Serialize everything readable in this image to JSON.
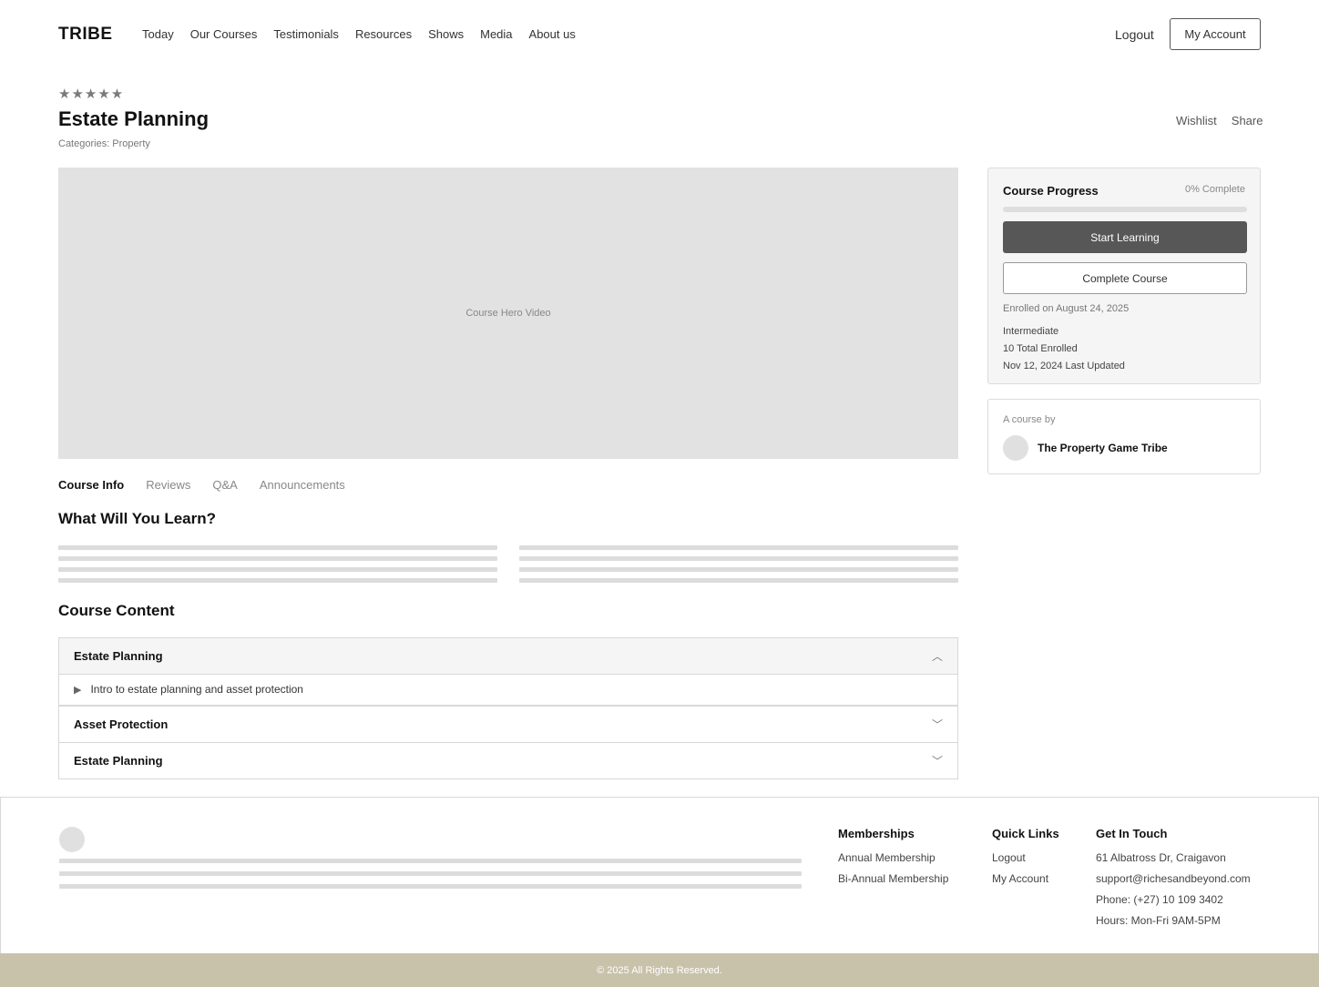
{
  "header": {
    "logo": "TRIBE",
    "nav": [
      "Today",
      "Our Courses",
      "Testimonials",
      "Resources",
      "Shows",
      "Media",
      "About us"
    ],
    "logout": "Logout",
    "my_account": "My Account"
  },
  "course": {
    "stars": "★★★★★",
    "rating_stars": 5,
    "title": "Estate Planning",
    "categories": "Categories: Property",
    "wishlist": "Wishlist",
    "share": "Share",
    "video_label": "Course Hero Video"
  },
  "tabs": [
    "Course Info",
    "Reviews",
    "Q&A",
    "Announcements"
  ],
  "learn": {
    "title": "What Will You Learn?"
  },
  "content": {
    "title": "Course Content",
    "topics": [
      {
        "label": "Estate Planning",
        "chevron": "︿",
        "lesson": "Intro to estate planning and asset protection"
      },
      {
        "label": "Asset Protection",
        "chevron": "﹀"
      },
      {
        "label": "Estate Planning",
        "chevron": "﹀"
      }
    ],
    "play_icon": "▶"
  },
  "progress": {
    "title": "Course Progress",
    "percent_label": "0% Complete",
    "percent_value": 0,
    "start_label": "Start Learning",
    "complete_label": "Complete Course",
    "enrolled_on": "Enrolled on August 24, 2025",
    "level": "Intermediate",
    "total_enrolled": "10 Total Enrolled",
    "last_updated": "Nov 12, 2024 Last Updated"
  },
  "author": {
    "label": "A course by",
    "name": "The Property Game Tribe"
  },
  "footer": {
    "memberships": {
      "title": "Memberships",
      "items": [
        "Annual Membership",
        "Bi-Annual Membership"
      ]
    },
    "quick_links": {
      "title": "Quick Links",
      "items": [
        "Logout",
        "My Account"
      ]
    },
    "contact": {
      "title": "Get In Touch",
      "items": [
        "61 Albatross Dr, Craigavon",
        "support@richesandbeyond.com",
        "Phone: (+27) 10 109 3402",
        "Hours: Mon-Fri 9AM-5PM"
      ]
    },
    "copyright": "© 2025 All Rights Reserved."
  }
}
